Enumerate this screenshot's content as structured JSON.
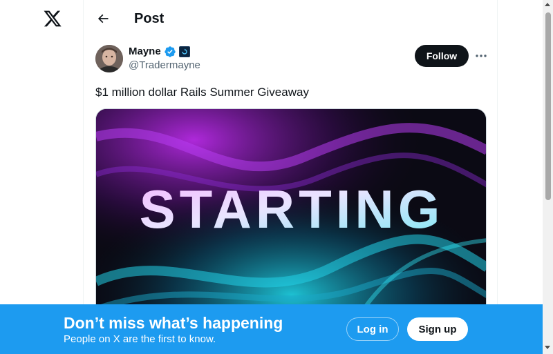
{
  "nav": {
    "logo_icon": "x-logo-icon"
  },
  "header": {
    "title": "Post",
    "back_icon": "arrow-left-icon"
  },
  "author": {
    "name": "Mayne",
    "handle": "@Tradermayne",
    "verified_color": "#1d9bf0",
    "affiliate_badge_color": "#0a2540"
  },
  "actions": {
    "follow_label": "Follow",
    "more_icon": "more-horizontal-icon"
  },
  "tweet": {
    "text": "$1 million dollar Rails Summer Giveaway",
    "media_text": "STARTING"
  },
  "banner": {
    "title": "Don’t miss what’s happening",
    "subtitle": "People on X are the first to know.",
    "login_label": "Log in",
    "signup_label": "Sign up",
    "background": "#1d9bf0"
  }
}
